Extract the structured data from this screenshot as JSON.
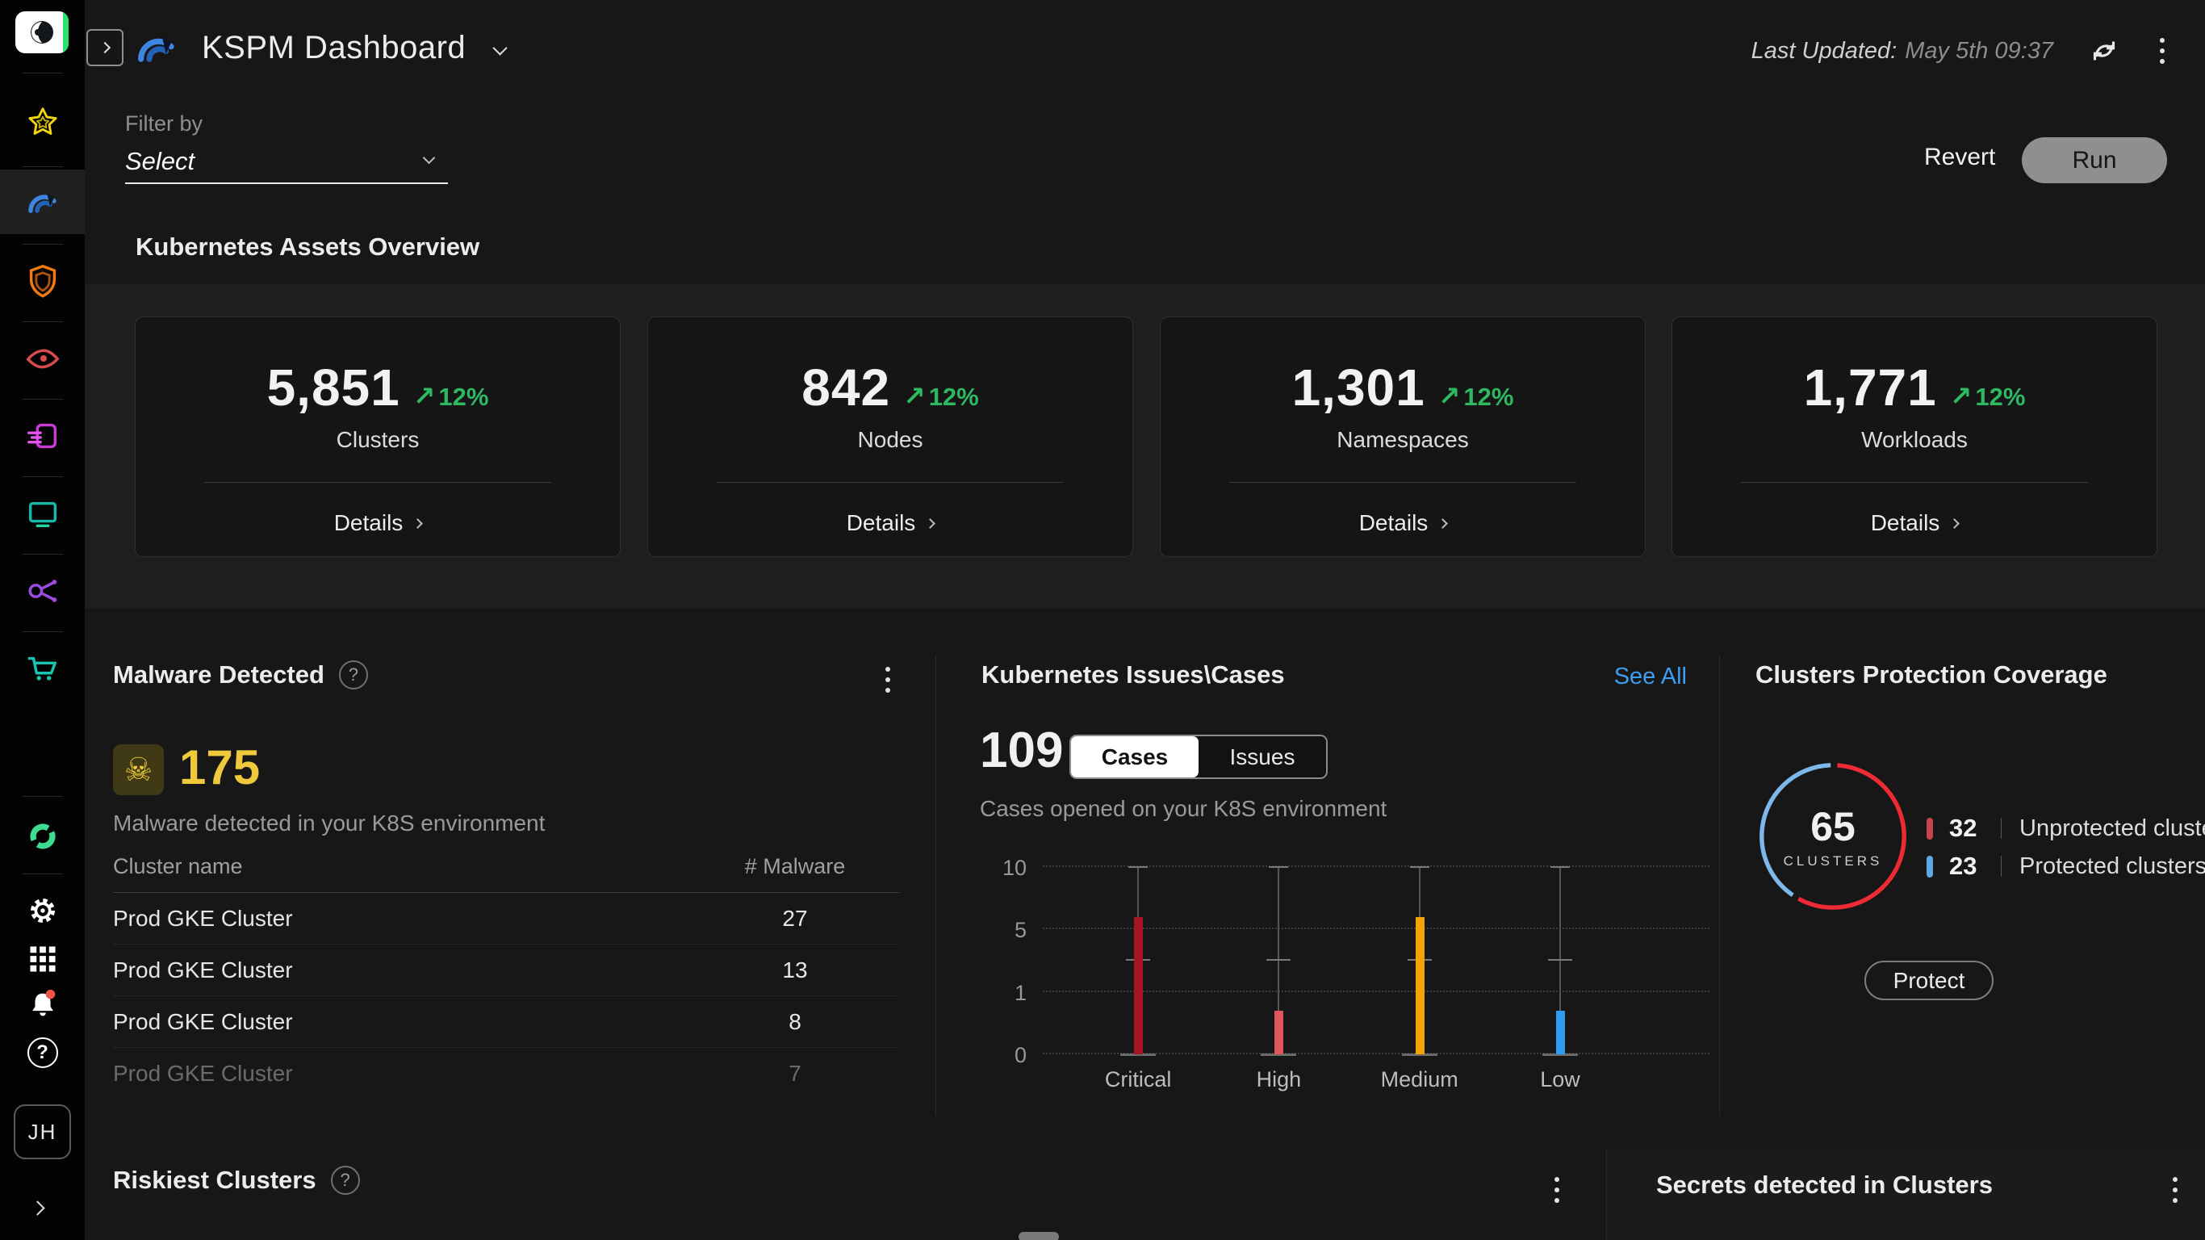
{
  "header": {
    "title": "KSPM Dashboard",
    "last_updated_label": "Last Updated:",
    "last_updated_value": "May 5th 09:37"
  },
  "filter": {
    "label": "Filter by",
    "select_value": "Select",
    "revert_label": "Revert",
    "run_label": "Run"
  },
  "icons": {
    "trend_up": "↗",
    "skull": "☠",
    "help": "?"
  },
  "sidebar": {
    "avatar_initials": "JH",
    "items": [
      "star-icon",
      "kspm-arcs-icon",
      "shield-icon",
      "eye-icon",
      "export-icon",
      "monitor-icon",
      "share-icon",
      "cart-icon",
      "loop-icon"
    ],
    "bottom_items": [
      "settings-gear-icon",
      "apps-grid-icon",
      "notifications-bell-icon",
      "help-icon"
    ]
  },
  "assets": {
    "title": "Kubernetes Assets Overview",
    "details_label": "Details",
    "cards": [
      {
        "value": "5,851",
        "trend": "12%",
        "label": "Clusters"
      },
      {
        "value": "842",
        "trend": "12%",
        "label": "Nodes"
      },
      {
        "value": "1,301",
        "trend": "12%",
        "label": "Namespaces"
      },
      {
        "value": "1,771",
        "trend": "12%",
        "label": "Workloads"
      }
    ]
  },
  "malware": {
    "title": "Malware Detected",
    "count": "175",
    "description": "Malware detected in your K8S environment",
    "table": {
      "headers": [
        "Cluster name",
        "# Malware"
      ],
      "rows": [
        {
          "name": "Prod GKE Cluster",
          "count": "27"
        },
        {
          "name": "Prod GKE Cluster",
          "count": "13"
        },
        {
          "name": "Prod GKE Cluster",
          "count": "8"
        },
        {
          "name": "Prod GKE Cluster",
          "count": "7"
        }
      ]
    }
  },
  "issues": {
    "title": "Kubernetes Issues\\Cases",
    "see_all": "See All",
    "count": "109",
    "tabs": [
      "Cases",
      "Issues"
    ],
    "active_tab": "Cases",
    "description": "Cases opened on your K8S environment"
  },
  "protection": {
    "title": "Clusters Protection Coverage",
    "center_value": "65",
    "center_label": "CLUSTERS",
    "legend": [
      {
        "value": "32",
        "label": "Unprotected clusters",
        "color": "#c8444c"
      },
      {
        "value": "23",
        "label": "Protected clusters",
        "color": "#5fa8e6"
      }
    ],
    "button_label": "Protect"
  },
  "bottom": {
    "riskiest_title": "Riskiest Clusters",
    "secrets_title": "Secrets detected in Clusters"
  },
  "chart_data": [
    {
      "type": "bar",
      "title": "Cases opened on your K8S environment",
      "categories": [
        "Critical",
        "High",
        "Medium",
        "Low"
      ],
      "values": [
        6,
        0.7,
        6,
        0.7
      ],
      "bar_colors": [
        "#a61622",
        "#e0565c",
        "#f5a302",
        "#2d9cf0"
      ],
      "range_low": 0,
      "range_high": 10,
      "range_mid": 3,
      "yticks": [
        0,
        1,
        5,
        10
      ],
      "ylim": [
        0,
        10
      ],
      "grid": "dotted-horizontal",
      "note": "each category shows a 0-10 whisker with mid tick at ~3 and a colored value bar"
    },
    {
      "type": "pie",
      "title": "Clusters Protection Coverage",
      "center_total": 65,
      "center_unit": "CLUSTERS",
      "slices": [
        {
          "label": "Unprotected clusters",
          "value": 32,
          "color": "#ee2b35"
        },
        {
          "label": "Protected clusters",
          "value": 23,
          "color": "#7cb9ea"
        }
      ],
      "legend_position": "right"
    }
  ]
}
